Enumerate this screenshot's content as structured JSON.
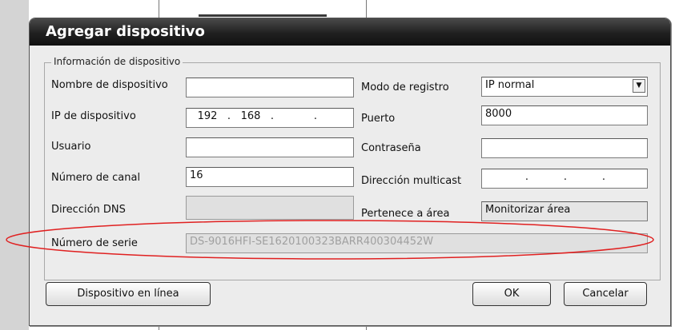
{
  "dialog": {
    "title": "Agregar dispositivo",
    "group_title": "Información de dispositivo"
  },
  "fields": {
    "device_name": {
      "label": "Nombre de dispositivo",
      "value": ""
    },
    "register_mode": {
      "label": "Modo de registro",
      "value": "IP normal"
    },
    "device_ip": {
      "label": "IP de dispositivo",
      "octets": [
        "192",
        "168",
        "",
        ""
      ]
    },
    "port": {
      "label": "Puerto",
      "value": "8000"
    },
    "user": {
      "label": "Usuario",
      "value": ""
    },
    "password": {
      "label": "Contraseña",
      "value": ""
    },
    "channel_count": {
      "label": "Número de canal",
      "value": "16"
    },
    "multicast": {
      "label": "Dirección multicast",
      "octets": [
        "",
        "",
        "",
        ""
      ]
    },
    "dns": {
      "label": "Dirección DNS",
      "value": ""
    },
    "area": {
      "label": "Pertenece a área",
      "value": "Monitorizar área"
    },
    "serial": {
      "label": "Número de serie",
      "value": "DS-9016HFI-SE1620100323BARR400304452W"
    }
  },
  "buttons": {
    "online": "Dispositivo en línea",
    "ok": "OK",
    "cancel": "Cancelar"
  },
  "annotation_color": "#e02020"
}
